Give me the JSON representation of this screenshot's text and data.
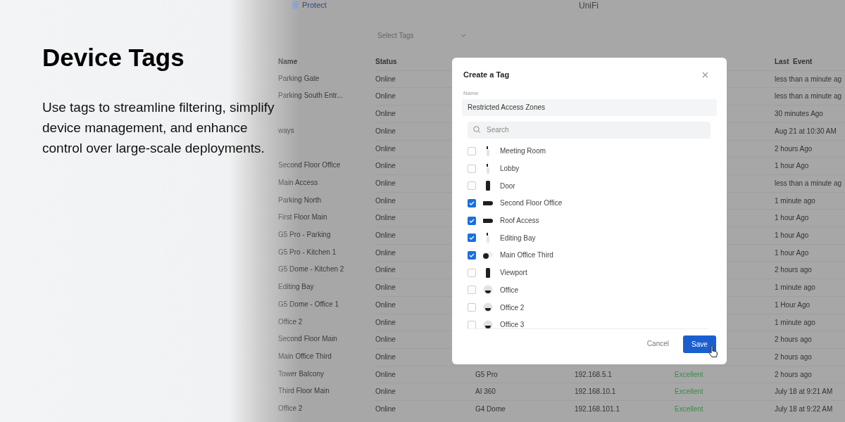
{
  "promo": {
    "title": "Device Tags",
    "text": "Use tags to streamline filtering, simplify device management, and enhance control over large-scale deployments."
  },
  "app": {
    "nav_item": "Protect",
    "title": "UniFi",
    "tag_filter": {
      "placeholder": "Select Tags"
    }
  },
  "table": {
    "columns": [
      "Name",
      "Status",
      "Last  Event"
    ],
    "rows": [
      {
        "name": "Parking Gate",
        "status": "Online",
        "last_event": "less than a minute ag"
      },
      {
        "name": "Parking South Entr...",
        "status": "Online",
        "last_event": "less than a minute ag"
      },
      {
        "status": "Online",
        "last_event": "30 minutes Ago"
      },
      {
        "name": "ways",
        "status": "Online",
        "last_event": "Aug 21 at 10:30 AM"
      },
      {
        "status": "Online",
        "last_event": "2 hours Ago"
      },
      {
        "name": "Second Floor Office",
        "status": "Online",
        "last_event": "1 hour Ago"
      },
      {
        "name": "Main Access",
        "status": "Online",
        "last_event": "less than a minute ag"
      },
      {
        "name": "Parking North",
        "status": "Online",
        "last_event": "1 minute ago"
      },
      {
        "name": "First Floor Main",
        "status": "Online",
        "last_event": "1 hour Ago"
      },
      {
        "name": "G5 Pro - Parking",
        "status": "Online",
        "last_event": "1 hour Ago"
      },
      {
        "name": "G5 Pro - Kitchen 1",
        "status": "Online",
        "last_event": "1 hour Ago"
      },
      {
        "name": "G5 Dome - Kitchen 2",
        "status": "Online",
        "last_event": "2 hours ago"
      },
      {
        "name": "Editing Bay",
        "status": "Online",
        "last_event": "1 minute ago"
      },
      {
        "name": "G5 Dome - Office 1",
        "status": "Online",
        "last_event": "1 Hour Ago"
      },
      {
        "name": "Office 2",
        "status": "Online",
        "last_event": "1 minute ago"
      },
      {
        "name": "Second Floor Main",
        "status": "Online",
        "last_event": "2 hours ago"
      },
      {
        "name": "Main Office Third",
        "status": "Online",
        "last_event": "2 hours ago"
      },
      {
        "name": "Tower Balcony",
        "status": "Online",
        "model": "G5 Pro",
        "ip": "192.168.5.1",
        "connection": "Excellent",
        "last_event": "2 hours ago"
      },
      {
        "name": "Third Floor Main",
        "status": "Online",
        "model": "AI 360",
        "ip": "192.168.10.1",
        "connection": "Excellent",
        "last_event": "July 18 at 9:21 AM"
      },
      {
        "name": "Office 2",
        "status": "Online",
        "model": "G4 Dome",
        "ip": "192.168.101.1",
        "connection": "Excellent",
        "last_event": "July 18 at 9:22 AM"
      }
    ]
  },
  "dialog": {
    "title": "Create a Tag",
    "name_label": "Name",
    "name_value": "Restricted Access Zones",
    "search": {
      "placeholder": "Search"
    },
    "devices": [
      {
        "label": "Meeting Room",
        "kind": "sensor",
        "checked": false
      },
      {
        "label": "Lobby",
        "kind": "sensor",
        "checked": false
      },
      {
        "label": "Door",
        "kind": "doorbell",
        "checked": false
      },
      {
        "label": "Second Floor Office",
        "kind": "bullet",
        "checked": true
      },
      {
        "label": "Roof Access",
        "kind": "bullet",
        "checked": true
      },
      {
        "label": "Editing Bay",
        "kind": "sensor",
        "checked": true
      },
      {
        "label": "Main Office Third",
        "kind": "turret",
        "checked": true
      },
      {
        "label": "Viewport",
        "kind": "doorbell",
        "checked": false
      },
      {
        "label": "Office",
        "kind": "dome",
        "checked": false
      },
      {
        "label": "Office 2",
        "kind": "dome",
        "checked": false
      },
      {
        "label": "Office 3",
        "kind": "dome",
        "checked": false
      }
    ],
    "buttons": {
      "cancel": "Cancel",
      "save": "Save"
    }
  }
}
